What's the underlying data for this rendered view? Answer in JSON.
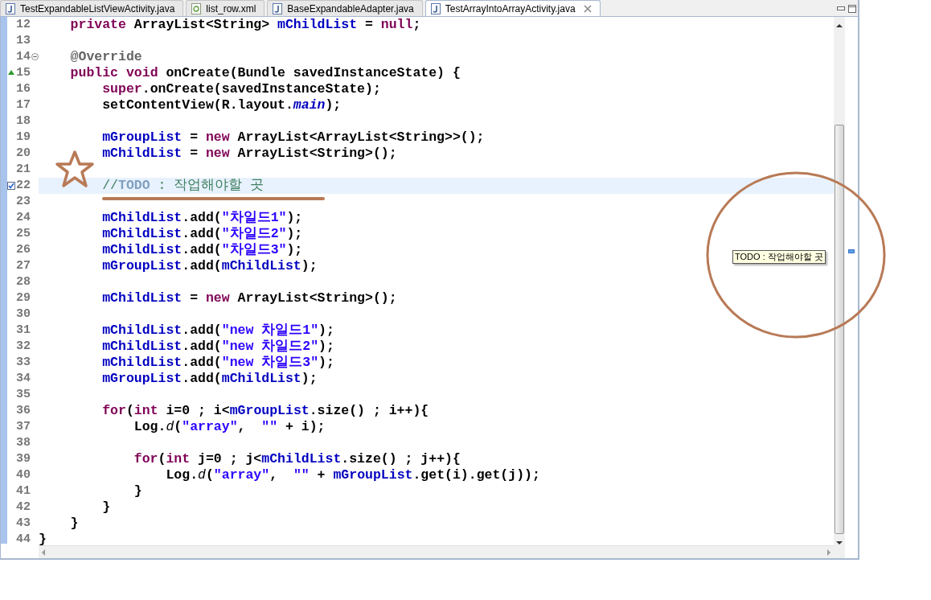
{
  "tabs": [
    {
      "label": "TestExpandableListViewActivity.java",
      "kind": "java",
      "selected": false
    },
    {
      "label": "list_row.xml",
      "kind": "xml",
      "selected": false
    },
    {
      "label": "BaseExpandableAdapter.java",
      "kind": "java",
      "selected": false
    },
    {
      "label": "TestArrayIntoArrayActivity.java",
      "kind": "java",
      "selected": true
    }
  ],
  "lines": [
    {
      "number": "12",
      "kind": "plain",
      "current": false,
      "tokens": [
        {
          "kind": "keyword",
          "text": "    private"
        },
        {
          "kind": "plain",
          "text": " ArrayList<String> "
        },
        {
          "kind": "field",
          "text": "mChildList"
        },
        {
          "kind": "plain",
          "text": " = "
        },
        {
          "kind": "keyword",
          "text": "null"
        },
        {
          "kind": "plain",
          "text": ";"
        }
      ]
    },
    {
      "number": "13",
      "kind": "plain",
      "current": false
    },
    {
      "number": "14",
      "kind": "fold",
      "current": false,
      "tokens": [
        {
          "kind": "annotation",
          "text": "    @Override"
        }
      ]
    },
    {
      "number": "15",
      "kind": "override",
      "current": false,
      "tokens": [
        {
          "kind": "keyword",
          "text": "    public"
        },
        {
          "kind": "keyword",
          "text": " void"
        },
        {
          "kind": "plain",
          "text": " onCreate(Bundle savedInstanceState) {"
        }
      ]
    },
    {
      "number": "16",
      "kind": "plain",
      "current": false,
      "tokens": [
        {
          "kind": "keyword",
          "text": "        super"
        },
        {
          "kind": "plain",
          "text": ".onCreate(savedInstanceState);"
        }
      ]
    },
    {
      "number": "17",
      "kind": "plain",
      "current": false,
      "tokens": [
        {
          "kind": "plain",
          "text": "        setContentView(R.layout."
        },
        {
          "kind": "static-field",
          "text": "main"
        },
        {
          "kind": "plain",
          "text": ");"
        }
      ]
    },
    {
      "number": "18",
      "kind": "plain",
      "current": false
    },
    {
      "number": "19",
      "kind": "plain",
      "current": false,
      "tokens": [
        {
          "kind": "field",
          "text": "        mGroupList"
        },
        {
          "kind": "plain",
          "text": " = "
        },
        {
          "kind": "keyword",
          "text": "new"
        },
        {
          "kind": "plain",
          "text": " ArrayList<ArrayList<String>>();"
        }
      ]
    },
    {
      "number": "20",
      "kind": "plain",
      "current": false,
      "tokens": [
        {
          "kind": "field",
          "text": "        mChildList"
        },
        {
          "kind": "plain",
          "text": " = "
        },
        {
          "kind": "keyword",
          "text": "new"
        },
        {
          "kind": "plain",
          "text": " ArrayList<String>();"
        }
      ]
    },
    {
      "number": "21",
      "kind": "plain",
      "current": false
    },
    {
      "number": "22",
      "kind": "task",
      "current": true,
      "tokens": [
        {
          "kind": "comment",
          "text": "        //"
        },
        {
          "kind": "task-tag",
          "text": "TODO"
        },
        {
          "kind": "comment",
          "text": " : 작업해야할 곳"
        }
      ]
    },
    {
      "number": "23",
      "kind": "plain",
      "current": false
    },
    {
      "number": "24",
      "kind": "plain",
      "current": false,
      "tokens": [
        {
          "kind": "field",
          "text": "        mChildList"
        },
        {
          "kind": "plain",
          "text": ".add("
        },
        {
          "kind": "string",
          "text": "\"차일드1\""
        },
        {
          "kind": "plain",
          "text": ");"
        }
      ]
    },
    {
      "number": "25",
      "kind": "plain",
      "current": false,
      "tokens": [
        {
          "kind": "field",
          "text": "        mChildList"
        },
        {
          "kind": "plain",
          "text": ".add("
        },
        {
          "kind": "string",
          "text": "\"차일드2\""
        },
        {
          "kind": "plain",
          "text": ");"
        }
      ]
    },
    {
      "number": "26",
      "kind": "plain",
      "current": false,
      "tokens": [
        {
          "kind": "field",
          "text": "        mChildList"
        },
        {
          "kind": "plain",
          "text": ".add("
        },
        {
          "kind": "string",
          "text": "\"차일드3\""
        },
        {
          "kind": "plain",
          "text": ");"
        }
      ]
    },
    {
      "number": "27",
      "kind": "plain",
      "current": false,
      "tokens": [
        {
          "kind": "field",
          "text": "        mGroupList"
        },
        {
          "kind": "plain",
          "text": ".add("
        },
        {
          "kind": "field",
          "text": "mChildList"
        },
        {
          "kind": "plain",
          "text": ");"
        }
      ]
    },
    {
      "number": "28",
      "kind": "plain",
      "current": false
    },
    {
      "number": "29",
      "kind": "plain",
      "current": false,
      "tokens": [
        {
          "kind": "field",
          "text": "        mChildList"
        },
        {
          "kind": "plain",
          "text": " = "
        },
        {
          "kind": "keyword",
          "text": "new"
        },
        {
          "kind": "plain",
          "text": " ArrayList<String>();"
        }
      ]
    },
    {
      "number": "30",
      "kind": "plain",
      "current": false
    },
    {
      "number": "31",
      "kind": "plain",
      "current": false,
      "tokens": [
        {
          "kind": "field",
          "text": "        mChildList"
        },
        {
          "kind": "plain",
          "text": ".add("
        },
        {
          "kind": "string",
          "text": "\"new 차일드1\""
        },
        {
          "kind": "plain",
          "text": ");"
        }
      ]
    },
    {
      "number": "32",
      "kind": "plain",
      "current": false,
      "tokens": [
        {
          "kind": "field",
          "text": "        mChildList"
        },
        {
          "kind": "plain",
          "text": ".add("
        },
        {
          "kind": "string",
          "text": "\"new 차일드2\""
        },
        {
          "kind": "plain",
          "text": ");"
        }
      ]
    },
    {
      "number": "33",
      "kind": "plain",
      "current": false,
      "tokens": [
        {
          "kind": "field",
          "text": "        mChildList"
        },
        {
          "kind": "plain",
          "text": ".add("
        },
        {
          "kind": "string",
          "text": "\"new 차일드3\""
        },
        {
          "kind": "plain",
          "text": ");"
        }
      ]
    },
    {
      "number": "34",
      "kind": "plain",
      "current": false,
      "tokens": [
        {
          "kind": "field",
          "text": "        mGroupList"
        },
        {
          "kind": "plain",
          "text": ".add("
        },
        {
          "kind": "field",
          "text": "mChildList"
        },
        {
          "kind": "plain",
          "text": ");"
        }
      ]
    },
    {
      "number": "35",
      "kind": "plain",
      "current": false
    },
    {
      "number": "36",
      "kind": "plain",
      "current": false,
      "tokens": [
        {
          "kind": "keyword",
          "text": "        for"
        },
        {
          "kind": "plain",
          "text": "("
        },
        {
          "kind": "keyword",
          "text": "int"
        },
        {
          "kind": "plain",
          "text": " i=0 ; i<"
        },
        {
          "kind": "field",
          "text": "mGroupList"
        },
        {
          "kind": "plain",
          "text": ".size() ; i++){"
        }
      ]
    },
    {
      "number": "37",
      "kind": "plain",
      "current": false,
      "tokens": [
        {
          "kind": "plain",
          "text": "            Log."
        },
        {
          "kind": "static-method",
          "text": "d"
        },
        {
          "kind": "plain",
          "text": "("
        },
        {
          "kind": "string",
          "text": "\"array\""
        },
        {
          "kind": "plain",
          "text": ",  "
        },
        {
          "kind": "string",
          "text": "\"\""
        },
        {
          "kind": "plain",
          "text": " + i);"
        }
      ]
    },
    {
      "number": "38",
      "kind": "plain",
      "current": false
    },
    {
      "number": "39",
      "kind": "plain",
      "current": false,
      "tokens": [
        {
          "kind": "keyword",
          "text": "            for"
        },
        {
          "kind": "plain",
          "text": "("
        },
        {
          "kind": "keyword",
          "text": "int"
        },
        {
          "kind": "plain",
          "text": " j=0 ; j<"
        },
        {
          "kind": "field",
          "text": "mChildList"
        },
        {
          "kind": "plain",
          "text": ".size() ; j++){"
        }
      ]
    },
    {
      "number": "40",
      "kind": "plain",
      "current": false,
      "tokens": [
        {
          "kind": "plain",
          "text": "                Log."
        },
        {
          "kind": "static-method",
          "text": "d"
        },
        {
          "kind": "plain",
          "text": "("
        },
        {
          "kind": "string",
          "text": "\"array\""
        },
        {
          "kind": "plain",
          "text": ",  "
        },
        {
          "kind": "string",
          "text": "\"\""
        },
        {
          "kind": "plain",
          "text": " + "
        },
        {
          "kind": "field",
          "text": "mGroupList"
        },
        {
          "kind": "plain",
          "text": ".get(i).get(j));"
        }
      ]
    },
    {
      "number": "41",
      "kind": "plain",
      "current": false,
      "tokens": [
        {
          "kind": "plain",
          "text": "            }"
        }
      ]
    },
    {
      "number": "42",
      "kind": "plain",
      "current": false,
      "tokens": [
        {
          "kind": "plain",
          "text": "        }"
        }
      ]
    },
    {
      "number": "43",
      "kind": "plain",
      "current": false,
      "tokens": [
        {
          "kind": "plain",
          "text": "    }"
        }
      ]
    },
    {
      "number": "44",
      "kind": "plain",
      "current": false,
      "tokens": [
        {
          "kind": "plain",
          "text": "}"
        }
      ]
    }
  ],
  "tooltip": {
    "text": "TODO : 작업해야할 곳"
  }
}
